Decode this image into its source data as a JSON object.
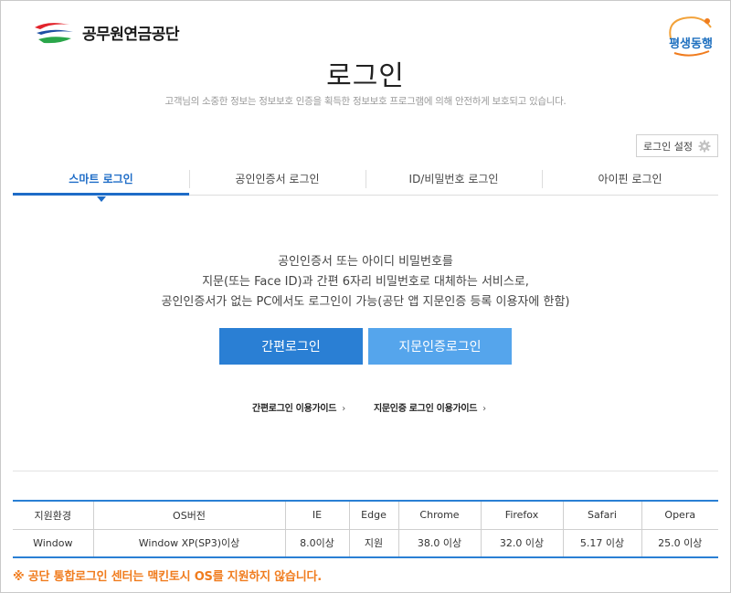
{
  "header": {
    "org_name": "공무원연금공단",
    "badge_text": "평생동행"
  },
  "page": {
    "title": "로그인",
    "description": "고객님의 소중한 정보는 정보보호 인증을 획득한 정보보호 프로그램에 의해 안전하게 보호되고 있습니다."
  },
  "login_settings": {
    "label": "로그인 설정",
    "icon": "gear-icon"
  },
  "tabs": [
    {
      "label": "스마트 로그인",
      "active": true
    },
    {
      "label": "공인인증서 로그인",
      "active": false
    },
    {
      "label": "ID/비밀번호 로그인",
      "active": false
    },
    {
      "label": "아이핀 로그인",
      "active": false
    }
  ],
  "intro": {
    "line1": "공인인증서 또는 아이디 비밀번호를",
    "line2": "지문(또는 Face ID)과 간편 6자리 비밀번호로 대체하는 서비스로,",
    "line3": "공인인증서가 없는 PC에서도 로그인이 가능(공단 앱 지문인증 등록 이용자에 한함)"
  },
  "buttons": {
    "easy_login": "간편로그인",
    "finger_login": "지문인증로그인"
  },
  "guides": {
    "easy_guide": "간편로그인 이용가이드",
    "finger_guide": "지문인증 로그인 이용가이드",
    "chevron": "›"
  },
  "env_table": {
    "headers": [
      "지원환경",
      "OS버전",
      "IE",
      "Edge",
      "Chrome",
      "Firefox",
      "Safari",
      "Opera"
    ],
    "row": [
      "Window",
      "Window XP(SP3)이상",
      "8.0이상",
      "지원",
      "38.0 이상",
      "32.0 이상",
      "5.17 이상",
      "25.0 이상"
    ]
  },
  "notice": "※ 공단 통합로그인 센터는 맥킨토시 OS를 지원하지 않습니다.",
  "colors": {
    "accent": "#1e6cc7",
    "button_primary": "#2a7fd4",
    "button_secondary": "#55a5ec",
    "notice": "#f07c1e"
  }
}
